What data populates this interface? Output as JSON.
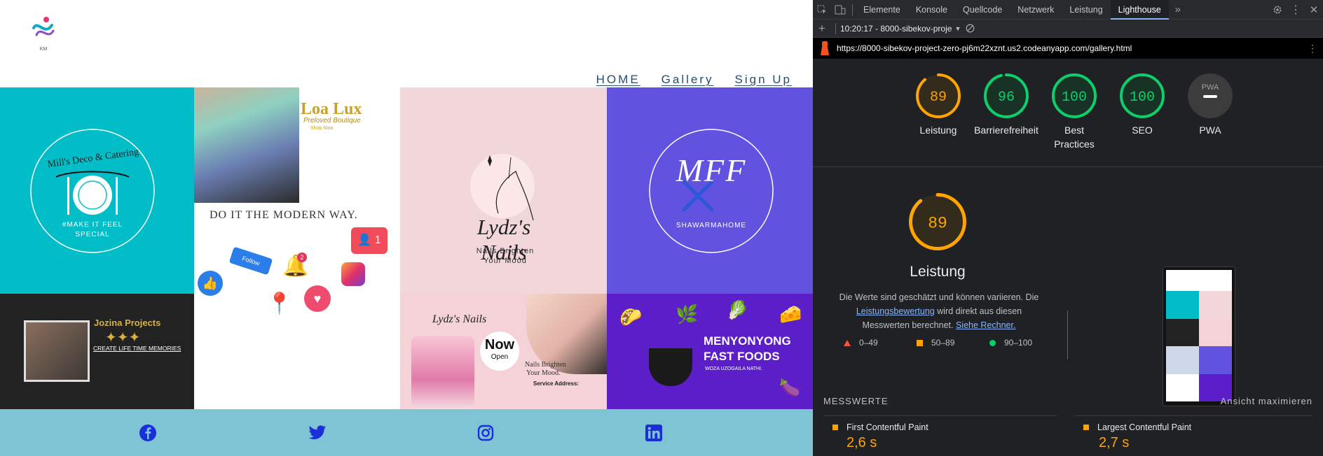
{
  "site": {
    "logo_caption": "KM",
    "nav": [
      {
        "label": "HOME"
      },
      {
        "label": "Gallery"
      },
      {
        "label": "Sign Up"
      }
    ],
    "tiles": {
      "mills": {
        "name": "Mill's Deco & Catering",
        "tagline": "#MAKE IT FEEL SPECIAL"
      },
      "lux": {
        "brand": "Loa Lux",
        "subtitle": "Preloved Boutique",
        "cta": "Shop Now",
        "headline": "DO IT THE MODERN WAY.",
        "notif_count": "1",
        "bell_count": "2",
        "follow": "Follow"
      },
      "lydz": {
        "brand": "Lydz's Nails",
        "tagline_1": "Nails Brighten",
        "tagline_2": "Your Mood"
      },
      "mff": {
        "monogram": "MFF",
        "name": "SHAWARMAHOME"
      },
      "jozina": {
        "name": "Jozina Projects",
        "tagline": "CREATE LIFE TIME MEMORIES"
      },
      "lydz2": {
        "brand": "Lydz's Nails",
        "now": "Now",
        "open": "Open",
        "tagline_1": "Nails Brighten",
        "tagline_2": "Your Mood.",
        "service": "Service Address:"
      },
      "menyo": {
        "title_1": "MENYONYONG",
        "title_2": "FAST FOODS",
        "slogan": "WOZA UZOGAILA NATHI."
      }
    },
    "social": [
      {
        "icon": "facebook-icon"
      },
      {
        "icon": "twitter-icon"
      },
      {
        "icon": "instagram-icon"
      },
      {
        "icon": "linkedin-icon"
      }
    ],
    "colors": {
      "teal": "#00bdc8",
      "pink": "#f2d7da",
      "purple": "#6152e0",
      "footer": "#7fc4d4",
      "social": "#1a2fd9",
      "nav": "#264d6b"
    }
  },
  "devtools": {
    "tabs": [
      {
        "label": "Elemente"
      },
      {
        "label": "Konsole"
      },
      {
        "label": "Quellcode"
      },
      {
        "label": "Netzwerk"
      },
      {
        "label": "Leistung"
      },
      {
        "label": "Lighthouse"
      }
    ],
    "active_tab": "Lighthouse",
    "report_selector": "10:20:17 - 8000-sibekov-proje",
    "url": "https://8000-sibekov-project-zero-pj6m22xznt.us2.codeanyapp.com/gallery.html",
    "scores": [
      {
        "label": "Leistung",
        "value": "89",
        "fraction": 0.89,
        "color": "#ffa400",
        "bg": "#332b1c"
      },
      {
        "label": "Barrierefreiheit",
        "value": "96",
        "fraction": 0.96,
        "color": "#0cce6b",
        "bg": "#183326"
      },
      {
        "label": "Best Practices",
        "value": "100",
        "fraction": 1.0,
        "color": "#0cce6b",
        "bg": "#183326"
      },
      {
        "label": "SEO",
        "value": "100",
        "fraction": 1.0,
        "color": "#0cce6b",
        "bg": "#183326"
      },
      {
        "label": "PWA",
        "value": "PWA",
        "fraction": 0,
        "color": "#9aa0a6",
        "bg": "#3c3c3c"
      }
    ],
    "performance": {
      "score": "89",
      "fraction": 0.89,
      "title": "Leistung",
      "desc_1": "Die Werte sind geschätzt und können variieren. Die",
      "link_1": "Leistungsbewertung",
      "desc_2": "wird direkt aus diesen Messwerten berechnet.",
      "link_2": "Siehe Rechner.",
      "legend": [
        {
          "range": "0–49",
          "color": "#ff4e42",
          "shape": "triangle"
        },
        {
          "range": "50–89",
          "color": "#ffa400",
          "shape": "square"
        },
        {
          "range": "90–100",
          "color": "#0cce6b",
          "shape": "circle"
        }
      ]
    },
    "metrics": {
      "header": "MESSWERTE",
      "expand": "Ansicht maximieren",
      "items": [
        {
          "label": "First Contentful Paint",
          "value": "2,6 s"
        },
        {
          "label": "Largest Contentful Paint",
          "value": "2,7 s"
        }
      ]
    }
  }
}
